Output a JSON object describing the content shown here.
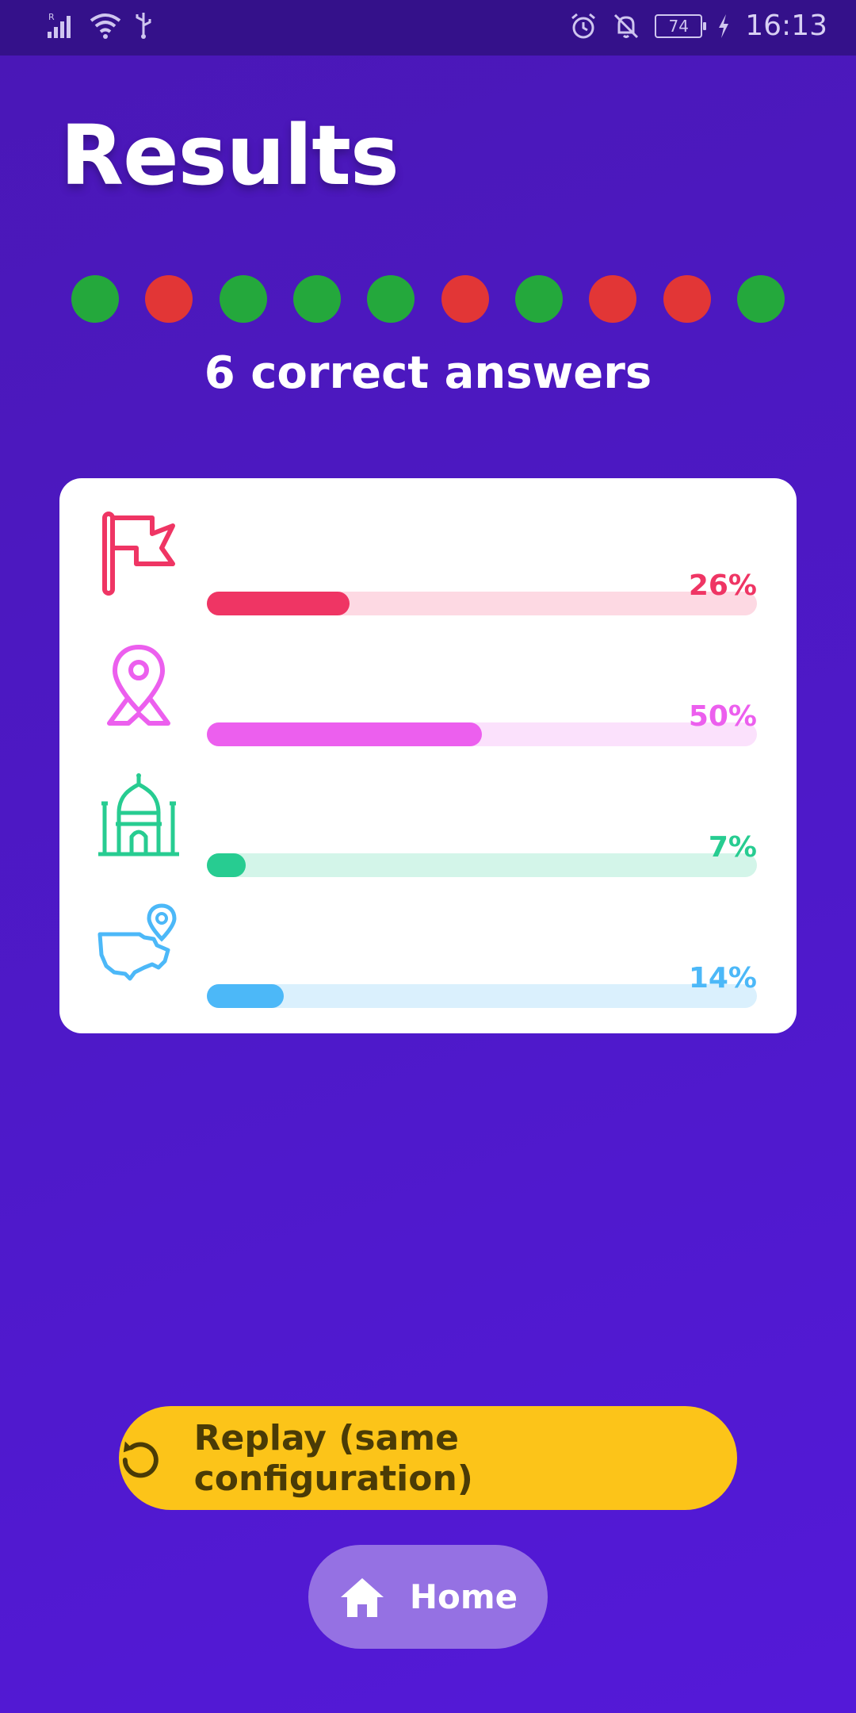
{
  "status_bar": {
    "time": "16:13",
    "battery": "74",
    "icons": [
      "signal-icon",
      "wifi-icon",
      "usb-icon",
      "alarm-icon",
      "mute-bell-icon",
      "battery-icon",
      "charging-icon"
    ]
  },
  "title": "Results",
  "answers": [
    "correct",
    "wrong",
    "correct",
    "correct",
    "correct",
    "wrong",
    "correct",
    "wrong",
    "wrong",
    "correct"
  ],
  "score_text": "6 correct answers",
  "stats": [
    {
      "category_icon": "flag-icon",
      "percent": 26,
      "label": "26%",
      "color": "#ef3564",
      "track_color": "#fdd9e3"
    },
    {
      "category_icon": "map-pin-icon",
      "percent": 50,
      "label": "50%",
      "color": "#ec5fee",
      "track_color": "#fbe1fc"
    },
    {
      "category_icon": "monument-icon",
      "percent": 7,
      "label": "7%",
      "color": "#27cc91",
      "track_color": "#d3f5e9"
    },
    {
      "category_icon": "country-map-icon",
      "percent": 14,
      "label": "14%",
      "color": "#4cb8f8",
      "track_color": "#daf0fd"
    }
  ],
  "buttons": {
    "replay_label": "Replay (same configuration)",
    "home_label": "Home"
  },
  "colors": {
    "correct": "#24a83c",
    "wrong": "#e23636",
    "replay_bg": "#fcc419",
    "home_bg": "#9571e3"
  }
}
